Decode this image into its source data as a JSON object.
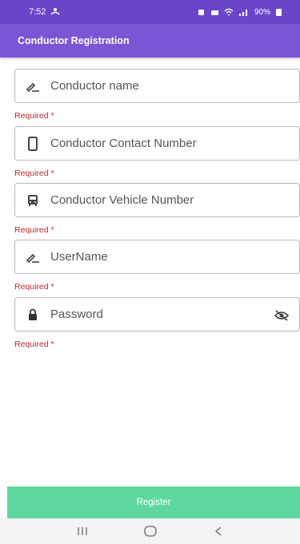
{
  "status_bar": {
    "time": "7:52",
    "battery": "90%"
  },
  "app_bar": {
    "title": "Conductor Registration"
  },
  "form": {
    "fields": [
      {
        "placeholder": "Conductor name",
        "icon": "pen-icon",
        "error": "Required *"
      },
      {
        "placeholder": "Conductor Contact Number",
        "icon": "phone-icon",
        "error": "Required *"
      },
      {
        "placeholder": "Conductor Vehicle Number",
        "icon": "bus-icon",
        "error": "Required *"
      },
      {
        "placeholder": "UserName",
        "icon": "pen-icon",
        "error": "Required *"
      },
      {
        "placeholder": "Password",
        "icon": "lock-icon",
        "trailing_icon": "eye-off-icon",
        "error": "Required *"
      }
    ]
  },
  "register_label": "Register",
  "colors": {
    "status_bar": "#6b45c9",
    "app_bar": "#7a55d6",
    "error": "#c0262b",
    "button": "#5fd8a0"
  }
}
